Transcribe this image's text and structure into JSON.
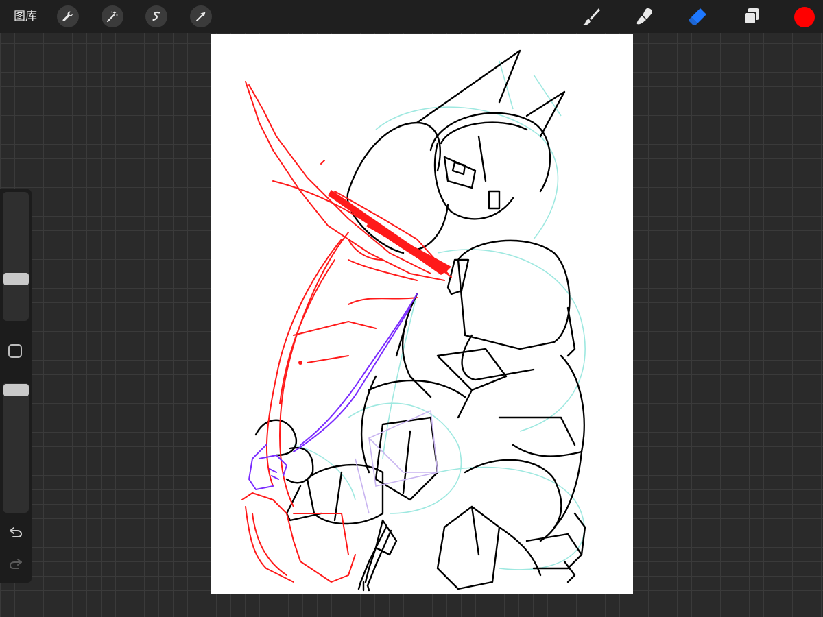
{
  "topbar": {
    "gallery_label": "图库",
    "left_tools": [
      {
        "icon": "wrench-icon"
      },
      {
        "icon": "magic-wand-icon"
      },
      {
        "icon": "selection-icon"
      },
      {
        "icon": "transform-arrow-icon"
      }
    ],
    "right_tools": [
      {
        "icon": "brush-icon"
      },
      {
        "icon": "smudge-icon"
      },
      {
        "icon": "eraser-icon",
        "active": true,
        "color": "#1e78ff"
      },
      {
        "icon": "layers-icon"
      }
    ],
    "current_color": "#ff0000"
  },
  "sidebar": {
    "brush_size": 0.45,
    "opacity": 1.0,
    "modify_icon": "square-icon",
    "undo_icon": "undo-icon",
    "redo_icon": "redo-icon"
  },
  "colors": {
    "accent": "#1e78ff",
    "sketch_red": "#ff1a1a",
    "sketch_purple": "#7a2bff",
    "guide_cyan": "#9ee8e0",
    "ink": "#000000"
  }
}
